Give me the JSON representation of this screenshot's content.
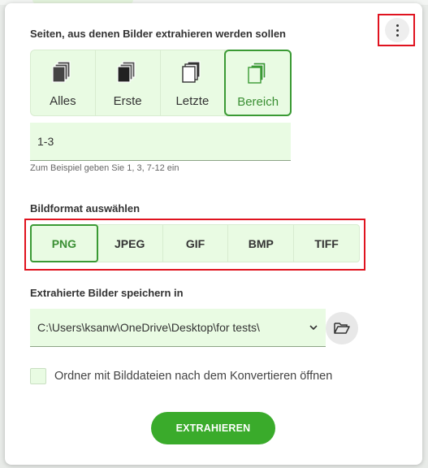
{
  "pages": {
    "label": "Seiten, aus denen Bilder extrahieren werden sollen",
    "options": [
      {
        "label": "Alles",
        "icon": "pages-all-icon"
      },
      {
        "label": "Erste",
        "icon": "pages-first-icon"
      },
      {
        "label": "Letzte",
        "icon": "pages-last-icon"
      },
      {
        "label": "Bereich",
        "icon": "pages-range-icon"
      }
    ],
    "selected": "Bereich",
    "range_value": "1-3",
    "hint": "Zum Beispiel geben Sie 1, 3, 7-12 ein"
  },
  "format": {
    "label": "Bildformat auswählen",
    "options": [
      "PNG",
      "JPEG",
      "GIF",
      "BMP",
      "TIFF"
    ],
    "selected": "PNG"
  },
  "save": {
    "label": "Extrahierte Bilder speichern in",
    "path": "C:\\Users\\ksanw\\OneDrive\\Desktop\\for tests\\"
  },
  "open_folder": {
    "label": "Ordner mit Bilddateien nach dem Konvertieren öffnen",
    "checked": false
  },
  "extract_button": "EXTRAHIEREN",
  "colors": {
    "accent": "#3aab2b",
    "selected_text": "#3a8f33",
    "field_bg": "#e9fbe3",
    "highlight_box": "#e0131f"
  }
}
